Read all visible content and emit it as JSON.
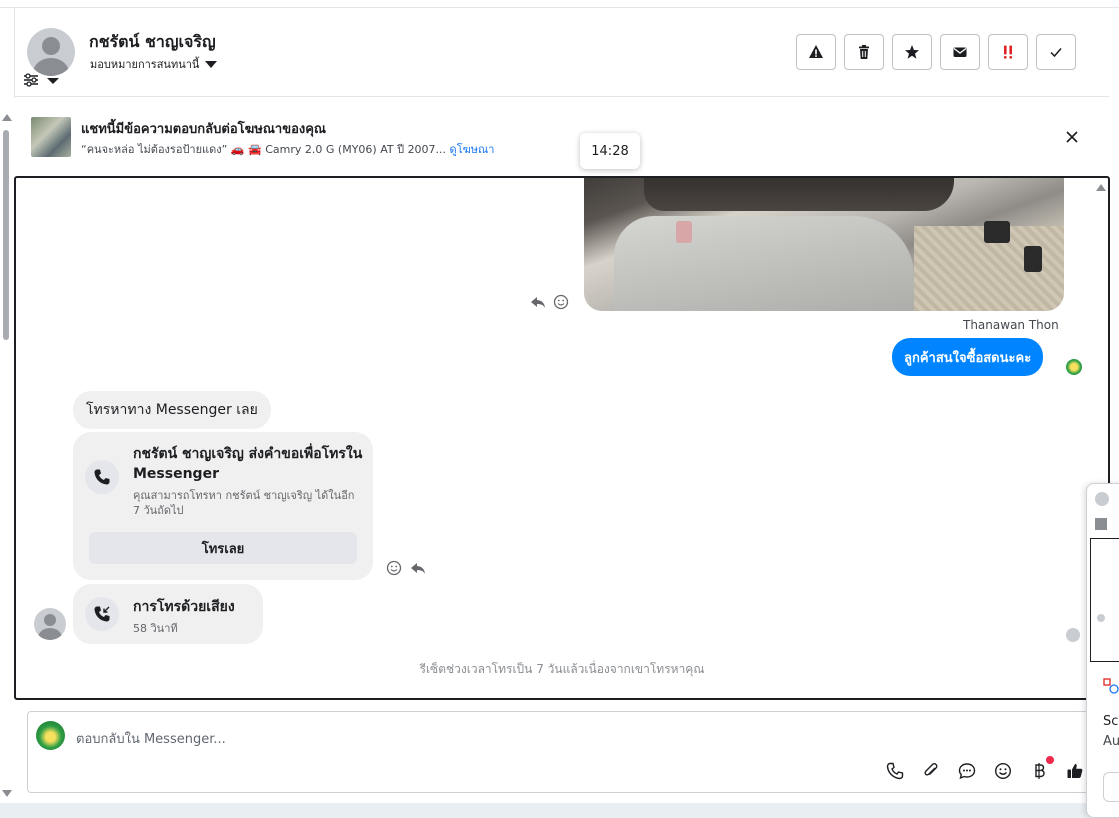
{
  "header": {
    "contact_name": "กชรัตน์ ชาญเจริญ",
    "assign_label": "มอบหมายการสนทนานี้",
    "actions": [
      {
        "name": "spam",
        "icon": "warning-icon"
      },
      {
        "name": "delete",
        "icon": "trash-icon"
      },
      {
        "name": "star",
        "icon": "star-icon"
      },
      {
        "name": "mark-unread",
        "icon": "envelope-icon"
      },
      {
        "name": "follow-up",
        "icon": "double-exclamation-icon",
        "color": "#e02424"
      },
      {
        "name": "done",
        "icon": "check-icon"
      }
    ]
  },
  "ad_banner": {
    "title": "แชทนี้มีข้อความตอบกลับต่อโฆษณาของคุณ",
    "description": "“คนจะหล่อ ไม่ต้องรอป้ายแดง” 🚗 🚘 Camry 2.0 G (MY06) AT ปี 2007...",
    "link": "ดูโฆษณา"
  },
  "tooltip": {
    "time": "14:28"
  },
  "conversation": {
    "sender_name": "Thanawan Thon",
    "outgoing_message": "ลูกค้าสนใจซื้อสดนะคะ",
    "incoming_message": "โทรหาทาง Messenger เลย",
    "call_request": {
      "title": "กชรัตน์ ชาญเจริญ ส่งคำขอเพื่อโทรใน Messenger",
      "subtitle": "คุณสามารถโทรหา กชรัตน์ ชาญเจริญ ได้ในอีก 7 วันถัดไป",
      "button": "โทรเลย"
    },
    "voice_call": {
      "title": "การโทรด้วยเสียง",
      "duration": "58 วินาที"
    },
    "reset_note": "รีเซ็ตช่วงเวลาโทรเป็น 7 วันแล้วเนื่องจากเขาโทรหาคุณ"
  },
  "composer": {
    "placeholder": "ตอบกลับใน Messenger...",
    "tools": [
      "phone-icon",
      "paperclip-icon",
      "chat-icon",
      "emoji-icon",
      "baht-icon",
      "thumbs-up-icon"
    ]
  },
  "side_window": {
    "line1": "Scr",
    "line2": "Au"
  },
  "colors": {
    "accent": "#0084ff",
    "link": "#1877f2",
    "alert": "#e02424"
  }
}
